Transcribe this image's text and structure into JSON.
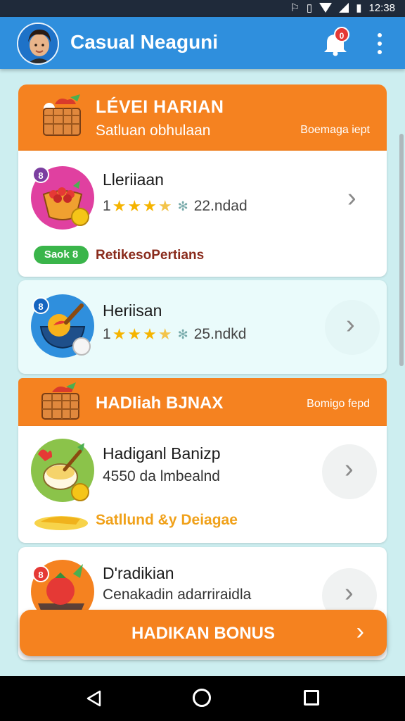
{
  "status_bar": {
    "time": "12:38"
  },
  "app_bar": {
    "title": "Casual Neaguni",
    "notification_count": "0"
  },
  "section_daily": {
    "title": "LÉVEI HARIAN",
    "subtitle": "Satluan obhulaan",
    "right_text": "Boemaga iept"
  },
  "items": [
    {
      "badge": "8",
      "title": "Lleriiaan",
      "level_prefix": "1",
      "rating": 4,
      "meta": "22.ndad",
      "chip": "Saok 8",
      "chip_text": "RetikesoPertians"
    },
    {
      "badge": "8",
      "title": "Heriisan",
      "level_prefix": "1",
      "rating": 3.5,
      "meta": "25.ndkd"
    }
  ],
  "section_bonus": {
    "title": "HADIiah BJNAX",
    "right_text": "Bomigo fepd"
  },
  "bonus_items": [
    {
      "title": "Hadiganl Banizp",
      "subtitle": "4550 da lmbealnd",
      "reward_text": "Satllund &y Deiagae"
    },
    {
      "badge": "8",
      "title": "D'radikian",
      "subtitle": "Cenakadin adarriraidla"
    }
  ],
  "bonus_button": {
    "label": "HADIKAN BONUS"
  },
  "colors": {
    "accent": "#f58220",
    "app_bar": "#2f8fdd",
    "background": "#cdeef0",
    "chip_green": "#3ab54a"
  },
  "icons": [
    "bell-icon",
    "more-vert-icon",
    "chevron-right-icon",
    "basket-icon",
    "back-icon",
    "home-icon",
    "recents-icon"
  ]
}
